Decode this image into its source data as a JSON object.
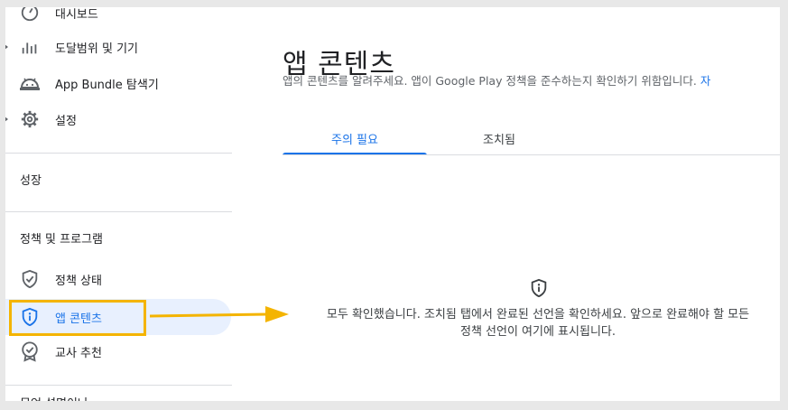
{
  "sidebar": {
    "items": [
      {
        "label": "대시보드",
        "icon": "dashboard-icon"
      },
      {
        "label": "도달범위 및 기기",
        "icon": "bar-chart-icon"
      },
      {
        "label": "App Bundle 탐색기",
        "icon": "android-icon"
      },
      {
        "label": "설정",
        "icon": "gear-icon"
      }
    ],
    "section_growth": "성장",
    "section_policy": "정책 및 프로그램",
    "policy_items": [
      {
        "label": "정책 상태",
        "icon": "shield-check-icon"
      },
      {
        "label": "앱 콘텐츠",
        "icon": "shield-info-icon"
      },
      {
        "label": "교사 추천",
        "icon": "badge-check-icon"
      }
    ],
    "partial_bottom": "무엇 설명이나"
  },
  "main": {
    "title": "앱 콘텐츠",
    "description": "앱의 콘텐츠를 알려주세요. 앱이 Google Play 정책을 준수하는지 확인하기 위함입니다.",
    "description_link": "자",
    "tabs": [
      "주의 필요",
      "조치됨"
    ],
    "empty_icon": "shield-info-icon",
    "empty_line1": "모두 확인했습니다. 조치됨 탭에서 완료된 선언을 확인하세요. 앞으로 완료해야 할 모든",
    "empty_line2": "정책 선언이 여기에 표시됩니다."
  },
  "colors": {
    "accent": "#1a73e8",
    "active_bg": "#e8f0fe",
    "annotation": "#f4b400",
    "text_secondary": "#5f6368"
  }
}
